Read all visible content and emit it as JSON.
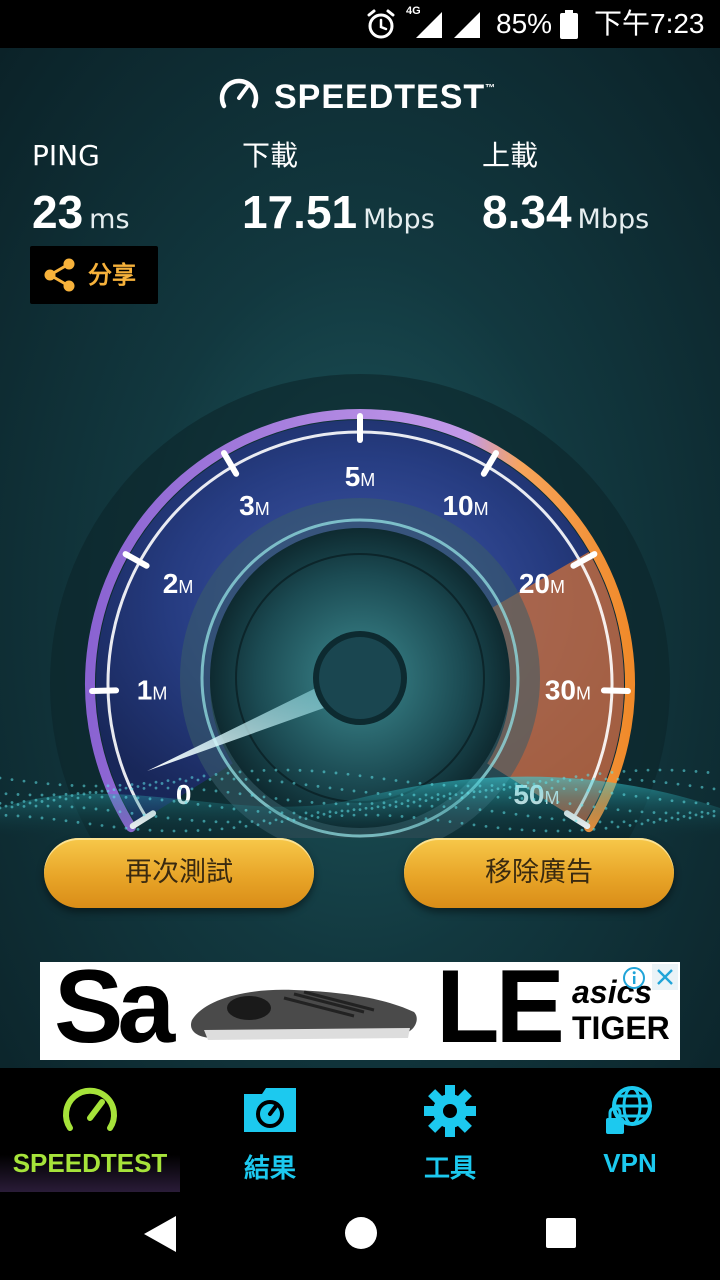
{
  "status_bar": {
    "network": "4G",
    "battery": "85%",
    "time": "下午7:23",
    "icons": [
      "alarm-icon",
      "signal-icon",
      "signal-icon",
      "battery-icon"
    ]
  },
  "app": {
    "logo": "SPEEDTEST",
    "trademark": "™"
  },
  "results": {
    "ping": {
      "label": "PING",
      "value": "23",
      "unit": "ms"
    },
    "download": {
      "label": "下載",
      "value": "17.51",
      "unit": "Mbps"
    },
    "upload": {
      "label": "上載",
      "value": "8.34",
      "unit": "Mbps"
    },
    "share_label": "分享"
  },
  "gauge": {
    "ticks": [
      {
        "num": "0",
        "unit": ""
      },
      {
        "num": "1",
        "unit": "M"
      },
      {
        "num": "2",
        "unit": "M"
      },
      {
        "num": "3",
        "unit": "M"
      },
      {
        "num": "5",
        "unit": "M"
      },
      {
        "num": "10",
        "unit": "M"
      },
      {
        "num": "20",
        "unit": "M"
      },
      {
        "num": "30",
        "unit": "M"
      },
      {
        "num": "50",
        "unit": "M"
      }
    ],
    "needle_value_fraction": 0.04
  },
  "buttons": {
    "retest": "再次測試",
    "remove_ads": "移除廣告"
  },
  "ad": {
    "text_left": "Sa",
    "text_right": "LE",
    "brand_top": "asics",
    "brand_bottom": "TIGER"
  },
  "tabs": [
    {
      "label": "SPEEDTEST",
      "icon": "speedometer-icon",
      "active": true
    },
    {
      "label": "結果",
      "icon": "results-folder-icon",
      "active": false
    },
    {
      "label": "工具",
      "icon": "gear-icon",
      "active": false
    },
    {
      "label": "VPN",
      "icon": "vpn-globe-lock-icon",
      "active": false
    }
  ],
  "colors": {
    "accent_cyan": "#1cc9ef",
    "accent_green": "#a6e33a",
    "accent_gold": "#f7b23b"
  }
}
